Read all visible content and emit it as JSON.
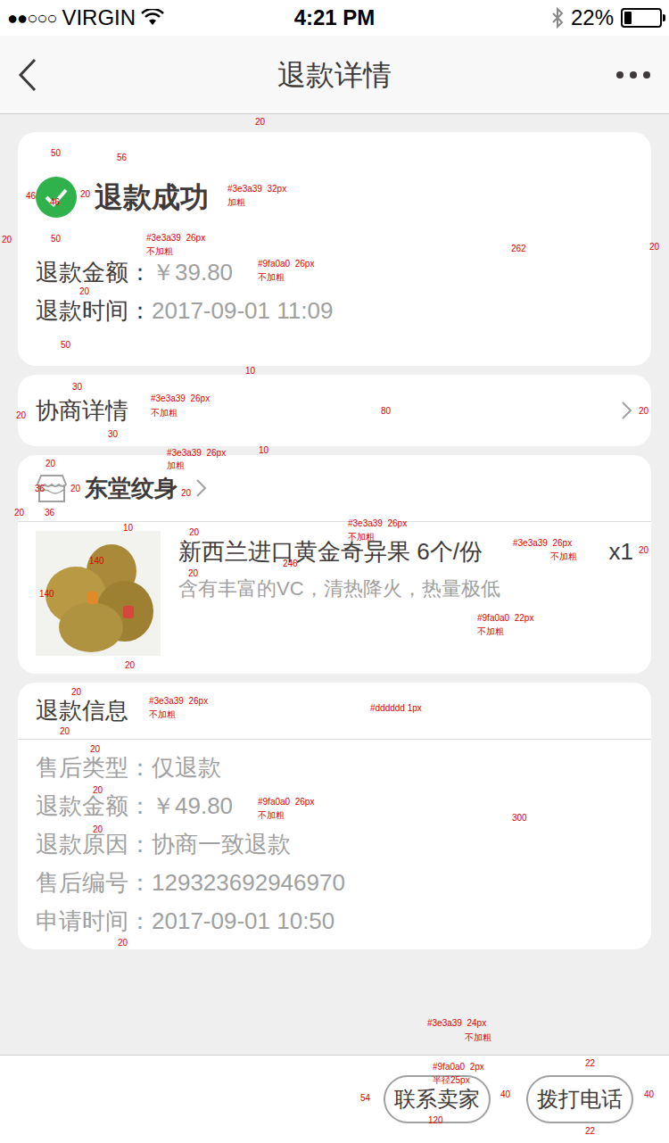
{
  "status_bar": {
    "signal": "●●○○○",
    "carrier": "VIRGIN",
    "time": "4:21 PM",
    "battery": "22%",
    "battery_level": 0.22
  },
  "nav": {
    "title": "退款详情"
  },
  "result": {
    "title": "退款成功",
    "rows": [
      {
        "label": "退款金额：",
        "value": "￥39.80"
      },
      {
        "label": "退款时间：",
        "value": "2017-09-01 11:09"
      }
    ]
  },
  "negotiation": {
    "label": "协商详情"
  },
  "order": {
    "shop": "东堂纹身",
    "product": {
      "title": "新西兰进口黄金奇异果 6个/份",
      "desc": "含有丰富的VC，清热降火，热量极低",
      "qty": "x1"
    }
  },
  "refund_info": {
    "title": "退款信息",
    "rows": [
      {
        "label": "售后类型：",
        "value": "仅退款"
      },
      {
        "label": "退款金额：",
        "value": "￥49.80"
      },
      {
        "label": "退款原因：",
        "value": "协商一致退款"
      },
      {
        "label": "售后编号：",
        "value": "129323692946970"
      },
      {
        "label": "申请时间：",
        "value": "2017-09-01 10:50"
      }
    ]
  },
  "buttons": [
    "联系卖家",
    "拨打电话"
  ],
  "annotations": [
    {
      "text": "20"
    },
    {
      "text": "50"
    },
    {
      "text": "56"
    },
    {
      "text": "#3e3a39  32px"
    },
    {
      "text": "加粗"
    },
    {
      "text": "46"
    },
    {
      "text": "46"
    },
    {
      "text": "20"
    },
    {
      "text": "20"
    },
    {
      "text": "262"
    },
    {
      "text": "20"
    },
    {
      "text": "50"
    },
    {
      "text": "#3e3a39  26px"
    },
    {
      "text": "不加粗"
    },
    {
      "text": "#9fa0a0  26px"
    },
    {
      "text": "不加粗"
    },
    {
      "text": "20"
    },
    {
      "text": "50"
    },
    {
      "text": "10"
    },
    {
      "text": "30"
    },
    {
      "text": "#3e3a39  26px"
    },
    {
      "text": "不加粗"
    },
    {
      "text": "20"
    },
    {
      "text": "80"
    },
    {
      "text": "20"
    },
    {
      "text": "30"
    },
    {
      "text": "#3e3a39  26px"
    },
    {
      "text": "加粗"
    },
    {
      "text": "10"
    },
    {
      "text": "20"
    },
    {
      "text": "36"
    },
    {
      "text": "20"
    },
    {
      "text": "20"
    },
    {
      "text": "20"
    },
    {
      "text": "36"
    },
    {
      "text": "10"
    },
    {
      "text": "20"
    },
    {
      "text": "#3e3a39  26px"
    },
    {
      "text": "不加粗"
    },
    {
      "text": "#3e3a39  26px"
    },
    {
      "text": "不加粗"
    },
    {
      "text": "20"
    },
    {
      "text": "140"
    },
    {
      "text": "140"
    },
    {
      "text": "246"
    },
    {
      "text": "20"
    },
    {
      "text": "#9fa0a0  22px"
    },
    {
      "text": "不加粗"
    },
    {
      "text": "20"
    },
    {
      "text": "20"
    },
    {
      "text": "#3e3a39  26px"
    },
    {
      "text": "不加粗"
    },
    {
      "text": "#dddddd 1px"
    },
    {
      "text": "20"
    },
    {
      "text": "20"
    },
    {
      "text": "20"
    },
    {
      "text": "20"
    },
    {
      "text": "300"
    },
    {
      "text": "#9fa0a0  26px"
    },
    {
      "text": "不加粗"
    },
    {
      "text": "20"
    },
    {
      "text": "#3e3a39  24px"
    },
    {
      "text": "不加粗"
    },
    {
      "text": "#9fa0a0  2px"
    },
    {
      "text": "半径25px"
    },
    {
      "text": "22"
    },
    {
      "text": "54"
    },
    {
      "text": "40"
    },
    {
      "text": "40"
    },
    {
      "text": "120"
    },
    {
      "text": "22"
    }
  ]
}
